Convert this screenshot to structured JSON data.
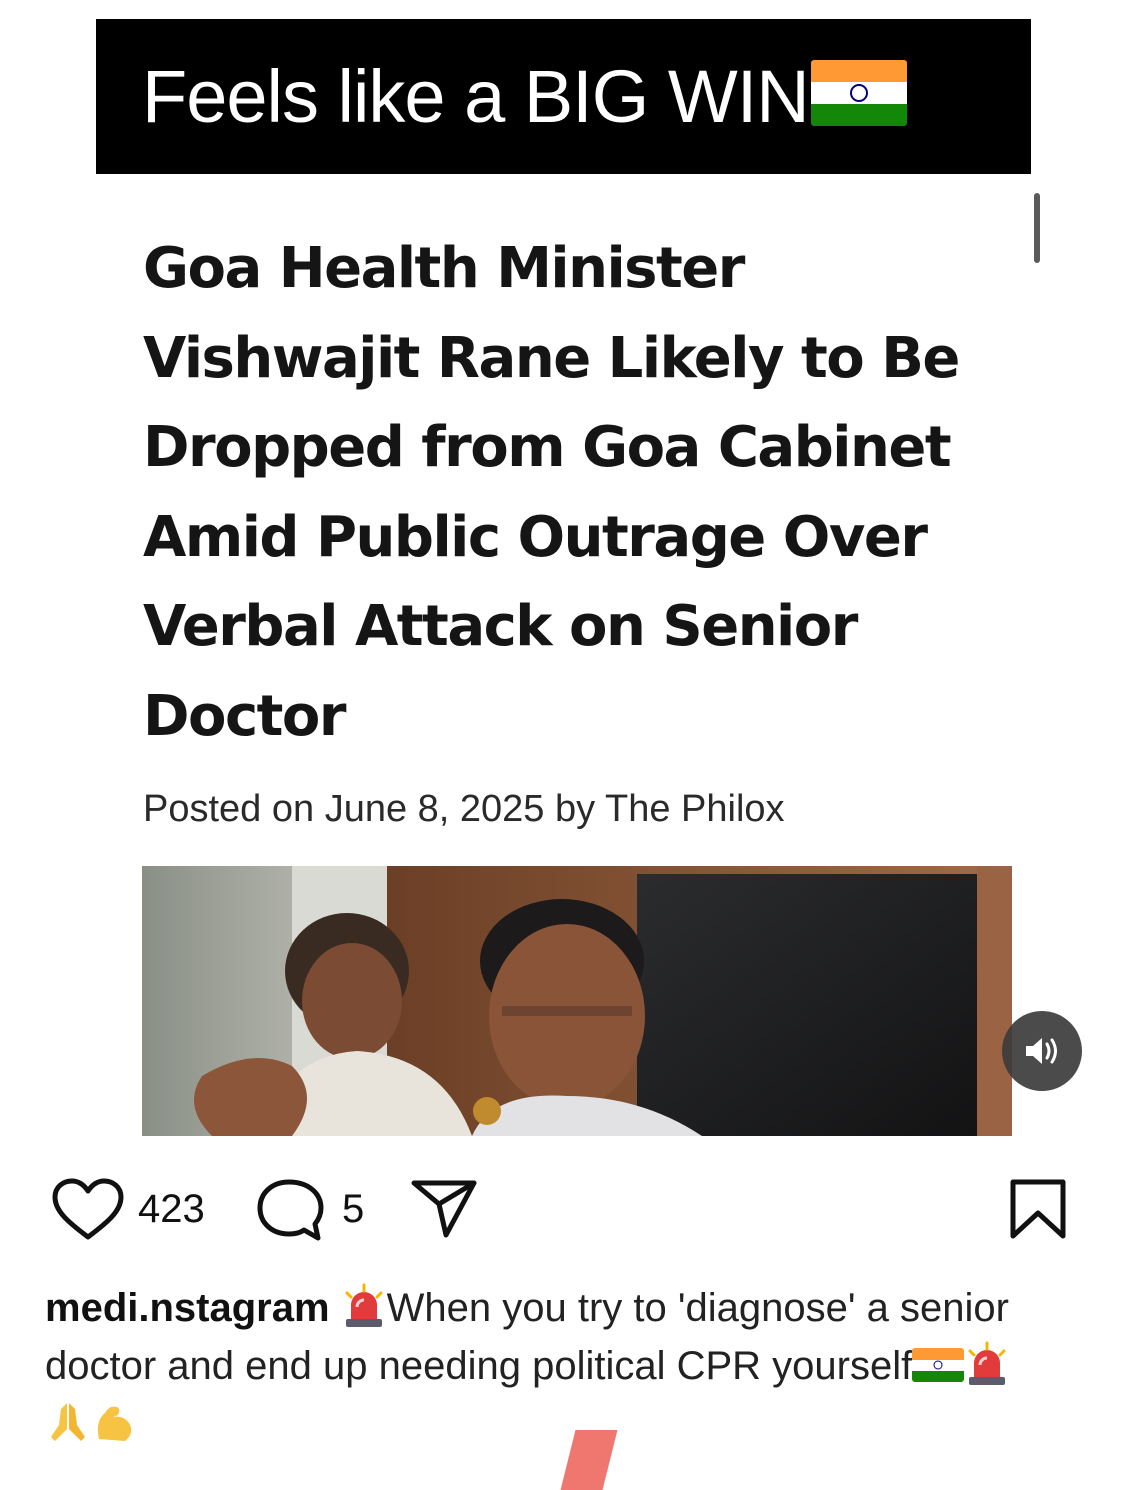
{
  "banner": {
    "text": "Feels like a BIG WIN",
    "emoji": "indian-flag"
  },
  "article": {
    "headline": "Goa Health Minister Vishwajit Rane Likely to Be Dropped from Goa Cabinet Amid Public Outrage Over Verbal Attack on Senior Doctor",
    "byline": "Posted on June 8, 2025 by The Philox"
  },
  "actions": {
    "likes": "423",
    "comments": "5"
  },
  "caption": {
    "username": "medi.nstagram",
    "line_text": "When you try to 'diagnose' a senior doctor and end up needing political CPR yourself",
    "emojis": [
      "siren",
      "indian-flag",
      "siren",
      "folded-hands",
      "flexed-biceps"
    ]
  },
  "colors": {
    "flag_saffron": "#FF9933",
    "flag_green": "#138808",
    "flag_chakra": "#000080",
    "banner_bg": "#000000"
  }
}
